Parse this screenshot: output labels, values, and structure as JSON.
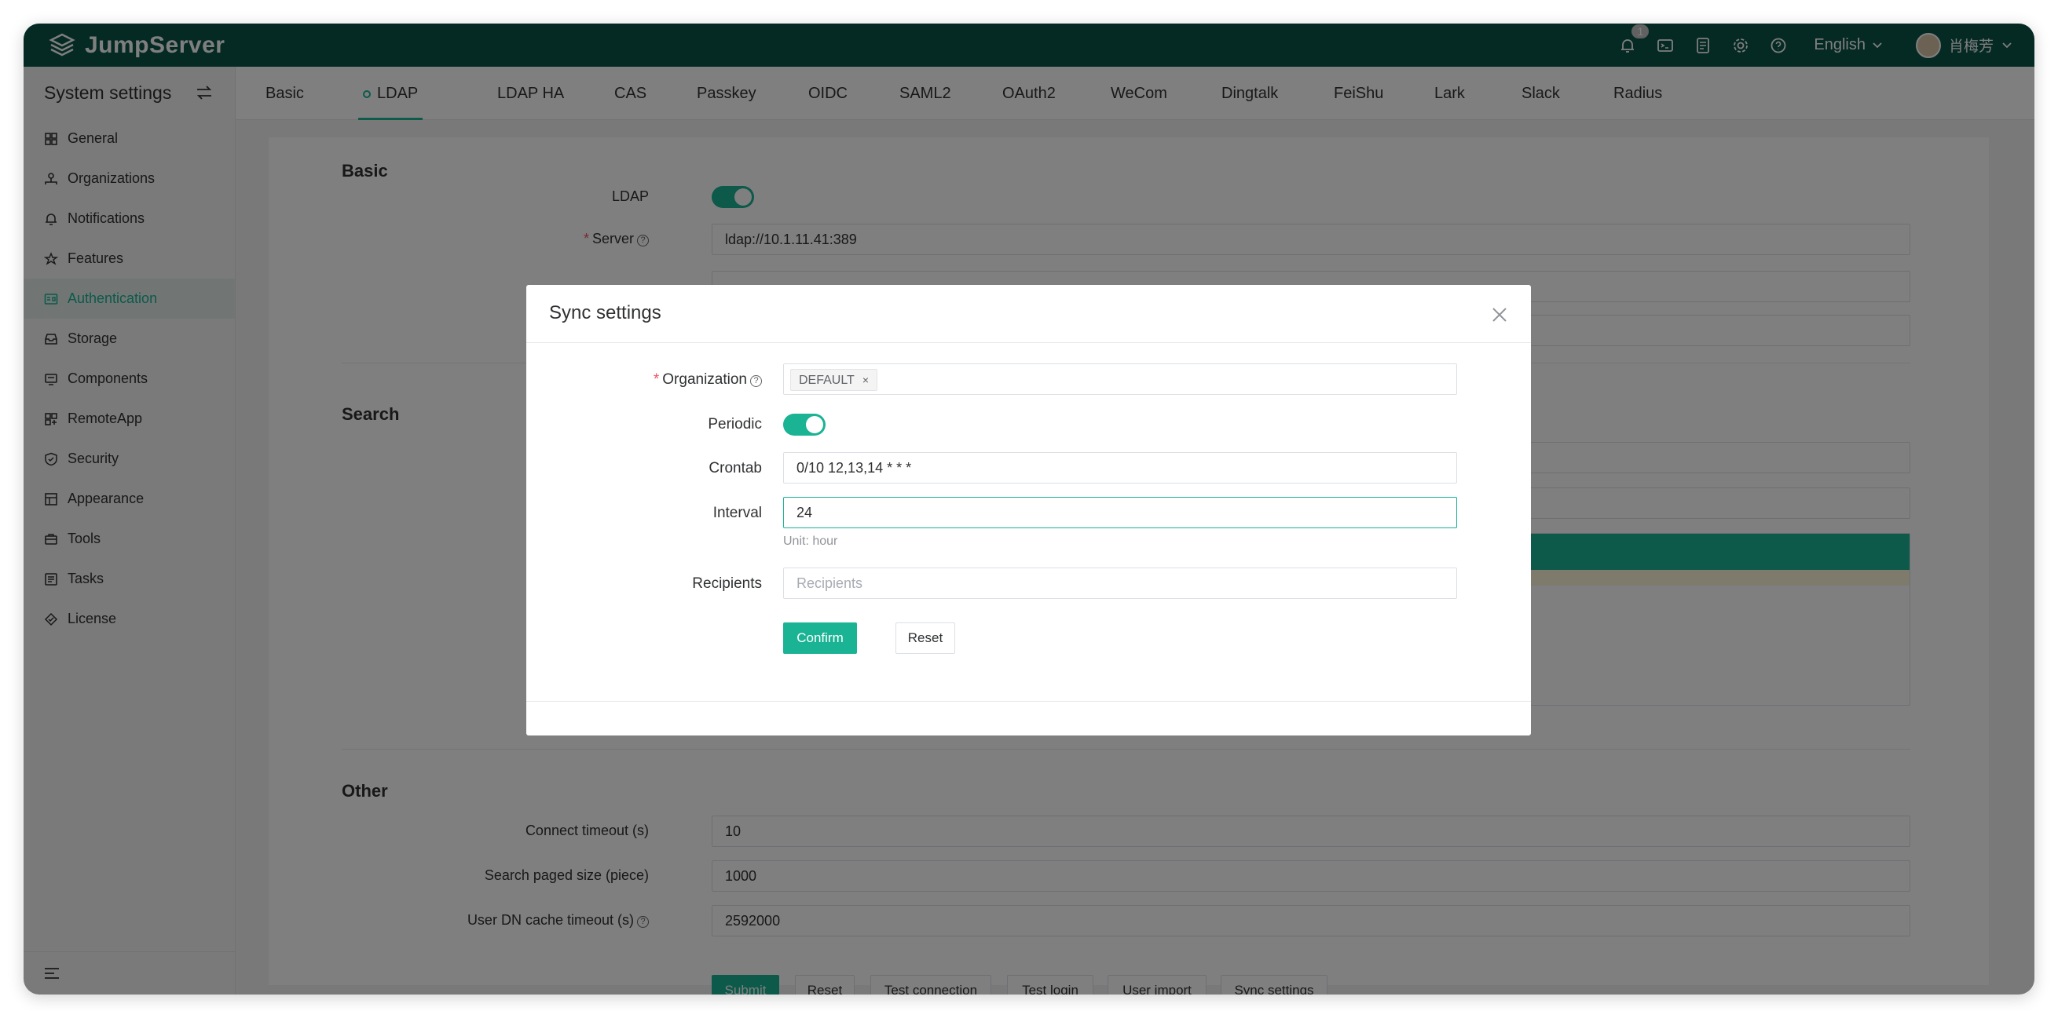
{
  "app": {
    "name": "JumpServer"
  },
  "header": {
    "notification_count": "1",
    "language": "English",
    "user_name": "肖梅芳"
  },
  "sidebar": {
    "title": "System settings",
    "items": [
      {
        "label": "General",
        "icon": "grid-icon"
      },
      {
        "label": "Organizations",
        "icon": "org-icon"
      },
      {
        "label": "Notifications",
        "icon": "bell-icon"
      },
      {
        "label": "Features",
        "icon": "star-icon"
      },
      {
        "label": "Authentication",
        "icon": "id-card-icon",
        "active": true
      },
      {
        "label": "Storage",
        "icon": "inbox-icon"
      },
      {
        "label": "Components",
        "icon": "monitor-icon"
      },
      {
        "label": "RemoteApp",
        "icon": "apps-icon"
      },
      {
        "label": "Security",
        "icon": "shield-icon"
      },
      {
        "label": "Appearance",
        "icon": "palette-icon"
      },
      {
        "label": "Tools",
        "icon": "toolbox-icon"
      },
      {
        "label": "Tasks",
        "icon": "list-icon"
      },
      {
        "label": "License",
        "icon": "badge-icon"
      }
    ]
  },
  "tabs": [
    "Basic",
    "LDAP",
    "LDAP HA",
    "CAS",
    "Passkey",
    "OIDC",
    "SAML2",
    "OAuth2",
    "WeCom",
    "Dingtalk",
    "FeiShu",
    "Lark",
    "Slack",
    "Radius"
  ],
  "active_tab": "LDAP",
  "form": {
    "basic_title": "Basic",
    "ldap_label": "LDAP",
    "ldap_enabled": true,
    "server_label": "Server",
    "server_value": "ldap://10.1.11.41:389",
    "search_title": "Search",
    "other_title": "Other",
    "connect_timeout_label": "Connect timeout (s)",
    "connect_timeout_value": "10",
    "paged_size_label": "Search paged size (piece)",
    "paged_size_value": "1000",
    "dn_cache_label": "User DN cache timeout (s)",
    "dn_cache_value": "2592000",
    "buttons": {
      "submit": "Submit",
      "reset": "Reset",
      "test_connection": "Test connection",
      "test_login": "Test login",
      "user_import": "User import",
      "sync_settings": "Sync settings"
    }
  },
  "dialog": {
    "title": "Sync settings",
    "organization_label": "Organization",
    "organization_tag": "DEFAULT",
    "periodic_label": "Periodic",
    "periodic_enabled": true,
    "crontab_label": "Crontab",
    "crontab_value": "0/10 12,13,14 * * *",
    "interval_label": "Interval",
    "interval_value": "24",
    "interval_hint": "Unit: hour",
    "recipients_label": "Recipients",
    "recipients_placeholder": "Recipients",
    "confirm": "Confirm",
    "reset": "Reset"
  },
  "colors": {
    "header_bg": "#0a5546",
    "accent": "#1ab394",
    "required": "#ed5565"
  }
}
